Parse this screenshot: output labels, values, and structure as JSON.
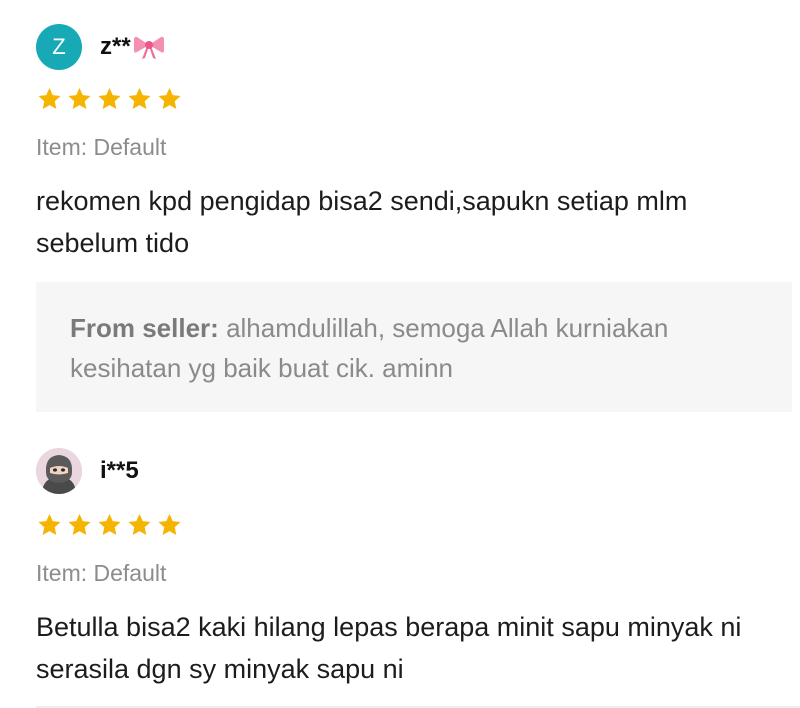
{
  "reviews": [
    {
      "avatar_letter": "Z",
      "username": "z**",
      "rating": 5,
      "item": "Item: Default",
      "text": "rekomen kpd pengidap bisa2 sendi,sapukn setiap mlm sebelum tido",
      "seller_reply": {
        "label": "From seller:",
        "text": "alhamdulillah, semoga Allah kurniakan kesihatan yg baik buat cik. aminn"
      }
    },
    {
      "username": "i**5",
      "rating": 5,
      "item": "Item: Default",
      "text": "Betulla bisa2 kaki hilang lepas berapa minit sapu minyak ni serasila dgn sy minyak sapu ni"
    }
  ],
  "colors": {
    "star": "#f5b400",
    "avatar_teal": "#17a9b5",
    "reply_bg": "#f6f6f6"
  },
  "icons": [
    "ribbon-bow-icon",
    "star-icon",
    "user-photo-avatar"
  ]
}
